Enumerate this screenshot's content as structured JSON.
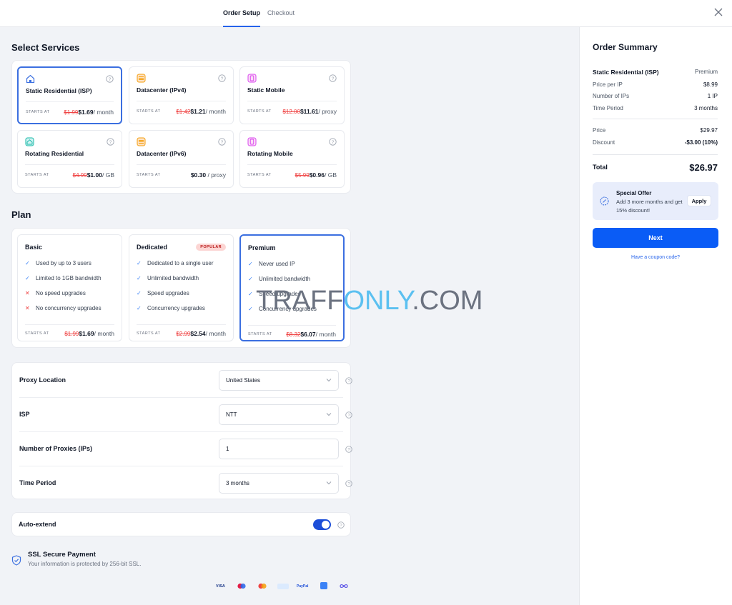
{
  "header": {
    "tabs": [
      "Order Setup",
      "Checkout"
    ],
    "close_icon": "close-icon"
  },
  "services": {
    "title": "Select Services",
    "items": [
      {
        "name": "Static Residential (ISP)",
        "icon": "house-icon",
        "starts": "STARTS AT",
        "old": "$1.99",
        "new": "$1.69",
        "unit": "/ month",
        "selected": true
      },
      {
        "name": "Datacenter (IPv4)",
        "icon": "server-icon",
        "starts": "STARTS AT",
        "old": "$1.42",
        "new": "$1.21",
        "unit": "/ month"
      },
      {
        "name": "Static Mobile",
        "icon": "phone-icon",
        "starts": "STARTS AT",
        "old": "$12.00",
        "new": "$11.61",
        "unit": "/ proxy"
      },
      {
        "name": "Rotating Residential",
        "icon": "house-rotate-icon",
        "starts": "STARTS AT",
        "old": "$4.99",
        "new": "$1.00",
        "unit": "/ GB"
      },
      {
        "name": "Datacenter (IPv6)",
        "icon": "server-icon",
        "starts": "STARTS AT",
        "old": "",
        "new": "$0.30",
        "unit": "/ proxy"
      },
      {
        "name": "Rotating Mobile",
        "icon": "phone-icon",
        "starts": "STARTS AT",
        "old": "$5.99",
        "new": "$0.96",
        "unit": "/ GB"
      }
    ]
  },
  "plan": {
    "title": "Plan",
    "items": [
      {
        "name": "Basic",
        "features": [
          {
            "text": "Used by up to 3 users",
            "ok": true
          },
          {
            "text": "Limited to 1GB bandwidth",
            "ok": true
          },
          {
            "text": "No speed upgrades",
            "ok": false
          },
          {
            "text": "No concurrency upgrades",
            "ok": false
          }
        ],
        "starts": "STARTS AT",
        "old": "$1.99",
        "new": "$1.69",
        "unit": "/ month"
      },
      {
        "name": "Dedicated",
        "badge": "POPULAR",
        "features": [
          {
            "text": "Dedicated to a single user",
            "ok": true
          },
          {
            "text": "Unlimited bandwidth",
            "ok": true
          },
          {
            "text": "Speed upgrades",
            "ok": true
          },
          {
            "text": "Concurrency upgrades",
            "ok": true
          }
        ],
        "starts": "STARTS AT",
        "old": "$2.99",
        "new": "$2.54",
        "unit": "/ month"
      },
      {
        "name": "Premium",
        "features": [
          {
            "text": "Never used IP",
            "ok": true
          },
          {
            "text": "Unlimited bandwidth",
            "ok": true
          },
          {
            "text": "Speed upgrades",
            "ok": true
          },
          {
            "text": "Concurrency upgrades",
            "ok": true
          }
        ],
        "starts": "STARTS AT",
        "old": "$8.32",
        "new": "$6.07",
        "unit": "/ month",
        "selected": true
      }
    ]
  },
  "config": {
    "location_label": "Proxy Location",
    "location_value": "United States",
    "isp_label": "ISP",
    "isp_value": "NTT",
    "count_label": "Number of Proxies (IPs)",
    "count_value": "1",
    "period_label": "Time Period",
    "period_value": "3 months",
    "autoextend_label": "Auto-extend",
    "autoextend_on": true
  },
  "watermark": {
    "part1": "TRAFF",
    "part2": "ONLY",
    "part3": ".COM"
  },
  "footer": {
    "ssl_title": "SSL Secure Payment",
    "ssl_sub": "Your information is protected by 256-bit SSL.",
    "payment_icons": [
      "VISA",
      "maestro-icon",
      "mastercard-icon",
      "amex-icon",
      "PayPal",
      "apple-pay-icon",
      "crypto-icon"
    ]
  },
  "summary": {
    "title": "Order Summary",
    "product": "Static Residential (ISP)",
    "product_plan": "Premium",
    "price_per_ip_label": "Price per IP",
    "price_per_ip": "$8.99",
    "num_ips_label": "Number of IPs",
    "num_ips": "1 IP",
    "period_label": "Time Period",
    "period": "3 months",
    "price_label": "Price",
    "price": "$29.97",
    "discount_label": "Discount",
    "discount": "-$3.00 (10%)",
    "total_label": "Total",
    "total": "$26.97",
    "offer_title": "Special Offer",
    "offer_desc": "Add 3 more months and get 15% discount!",
    "apply_label": "Apply",
    "next_label": "Next",
    "coupon_label": "Have a coupon code?"
  },
  "colors": {
    "accent": "#0a5cf6",
    "selected_border": "#3b6fe0",
    "strike": "#ef4444"
  }
}
